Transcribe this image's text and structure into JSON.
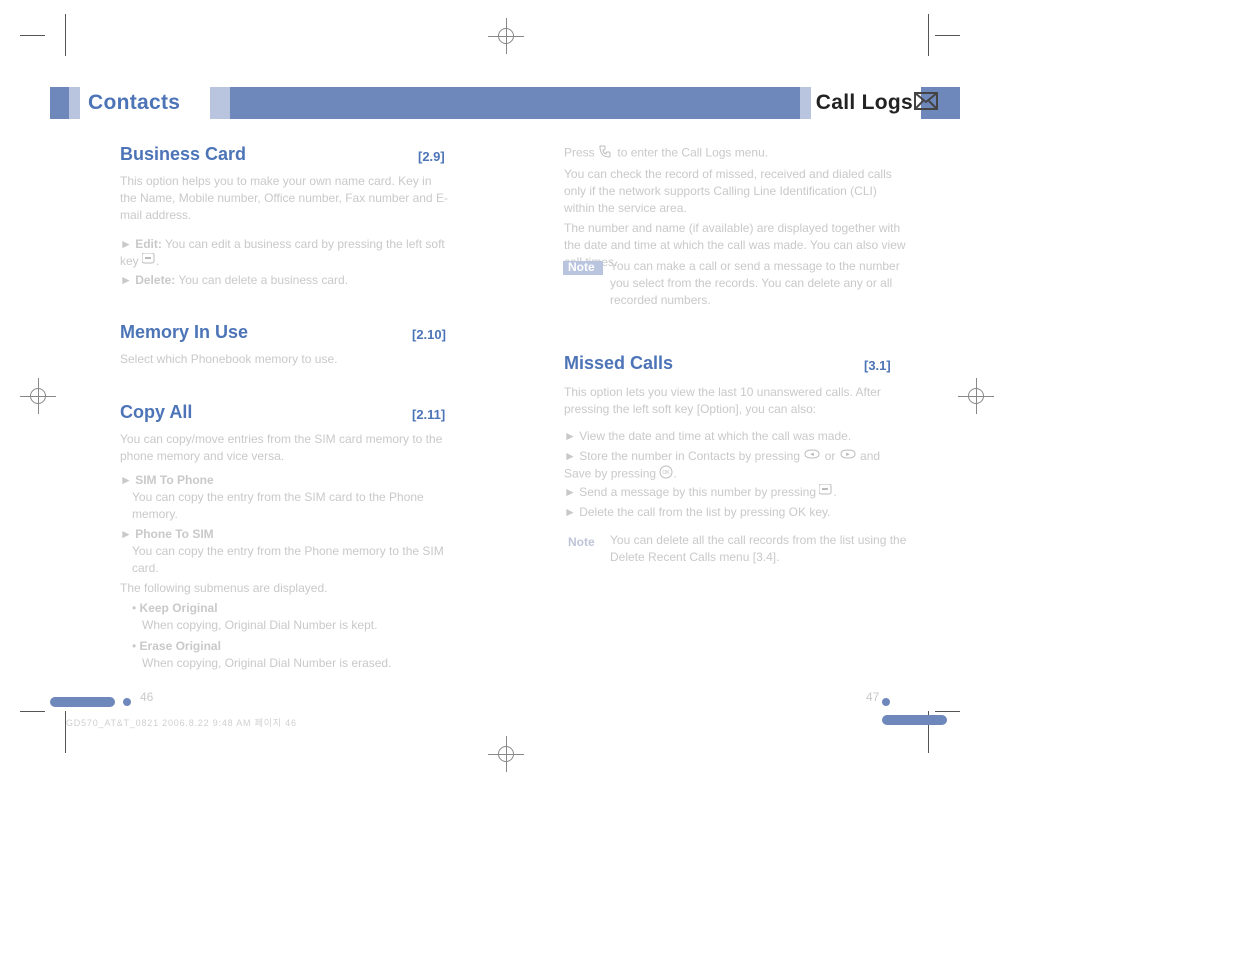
{
  "header": {
    "left_tab": "Contacts",
    "right_tab": "Call Logs"
  },
  "left_page": {
    "sections": {
      "business_card": {
        "title": "Business Card",
        "code": "[2.9]"
      },
      "memory_in_use": {
        "title": "Memory In Use",
        "code": "[2.10]"
      },
      "copy_all": {
        "title": "Copy All",
        "code": "[2.11]"
      }
    },
    "business_card": {
      "p1": "This option helps you to make your own name card. Key in the Name, Mobile number, Office number, Fax number and E-mail address.",
      "edit_label": "Edit:",
      "edit_text": " You can edit a business card by pressing the left soft key ",
      "delete_label": "Delete:",
      "delete_text": " You can delete a business card."
    },
    "memory_in_use_text": "Select which Phonebook memory to use.",
    "copy_all": {
      "p1": "You can copy/move entries from the SIM card memory to the phone memory and vice versa.",
      "sim_to_phone_label": "SIM To Phone",
      "sim_to_phone_text": "You can copy the entry from the SIM card to the Phone memory.",
      "phone_to_sim_label": "Phone To SIM",
      "phone_to_sim_text": "You can copy the entry from the Phone memory to the SIM card.",
      "submenus_intro": "The following submenus are displayed.",
      "keep_label": "Keep Original",
      "keep_text": "When copying, Original Dial Number is kept.",
      "erase_label": "Erase Original",
      "erase_text": "When copying, Original Dial Number is erased."
    },
    "page_number": "46"
  },
  "right_page": {
    "intro": {
      "p1": "Press ",
      "p1b": " to enter the Call Logs menu.",
      "p2": "You can check the record of missed, received and dialed calls only if the network supports Calling Line Identification (CLI) within the service area.",
      "p3": "The number and name (if available) are displayed together with the date and time at which the call was made. You can also view call times."
    },
    "note_label": "Note",
    "note_text": "You can make a call or send a message to the number you select from the records. You can delete any or all recorded numbers.",
    "missed_calls": {
      "title": "Missed Calls",
      "code": "[3.1]"
    },
    "missed": {
      "p1": "This option lets you view the last 10 unanswered calls. After pressing the left soft key [Option], you can also:",
      "b1": "View the date and time at which the call was made.",
      "b2a": "Store the number in Contacts by pressing ",
      "b2b": " or ",
      "b2c": " and Save by pressing ",
      "b3a": "Send a message by this number by pressing ",
      "b4": "Delete the call from the list by pressing OK key."
    },
    "note2_label": "Note",
    "note2_text": "You can delete all the call records from the list using the Delete Recent Calls menu [3.4].",
    "page_number": "47"
  },
  "footer": {
    "print_line": "GD570_AT&T_0821    2006.8.22    9:48 AM    페이지 46"
  },
  "icons": {
    "envelope": "envelope-icon",
    "softkey": "softkey-icon",
    "phone": "phone-icon",
    "left_arrow_key": "left-arrow-key-icon",
    "right_arrow_key": "right-arrow-key-icon",
    "ok_key": "ok-key-icon"
  }
}
